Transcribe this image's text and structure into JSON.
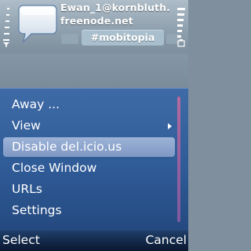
{
  "header": {
    "title_line1": "Ewan_1@kornbluth.",
    "title_line2": "freenode.net",
    "channel": "#mobitopia"
  },
  "icons": {
    "signal": "signal-strength-icon",
    "battery": "battery-icon",
    "app": "chat-bubble-icon"
  },
  "menu": {
    "items": [
      {
        "label": "Away ...",
        "has_submenu": false,
        "selected": false
      },
      {
        "label": "View",
        "has_submenu": true,
        "selected": false
      },
      {
        "label": "Disable del.icio.us",
        "has_submenu": false,
        "selected": true
      },
      {
        "label": "Close Window",
        "has_submenu": false,
        "selected": false
      },
      {
        "label": "URLs",
        "has_submenu": false,
        "selected": false
      },
      {
        "label": "Settings",
        "has_submenu": false,
        "selected": false
      }
    ]
  },
  "softkeys": {
    "left": "Select",
    "right": "Cancel"
  },
  "colors": {
    "menu_bg": "#2f5b97",
    "highlight": "#8fa6cf",
    "header_bg": "#9aabb8"
  }
}
